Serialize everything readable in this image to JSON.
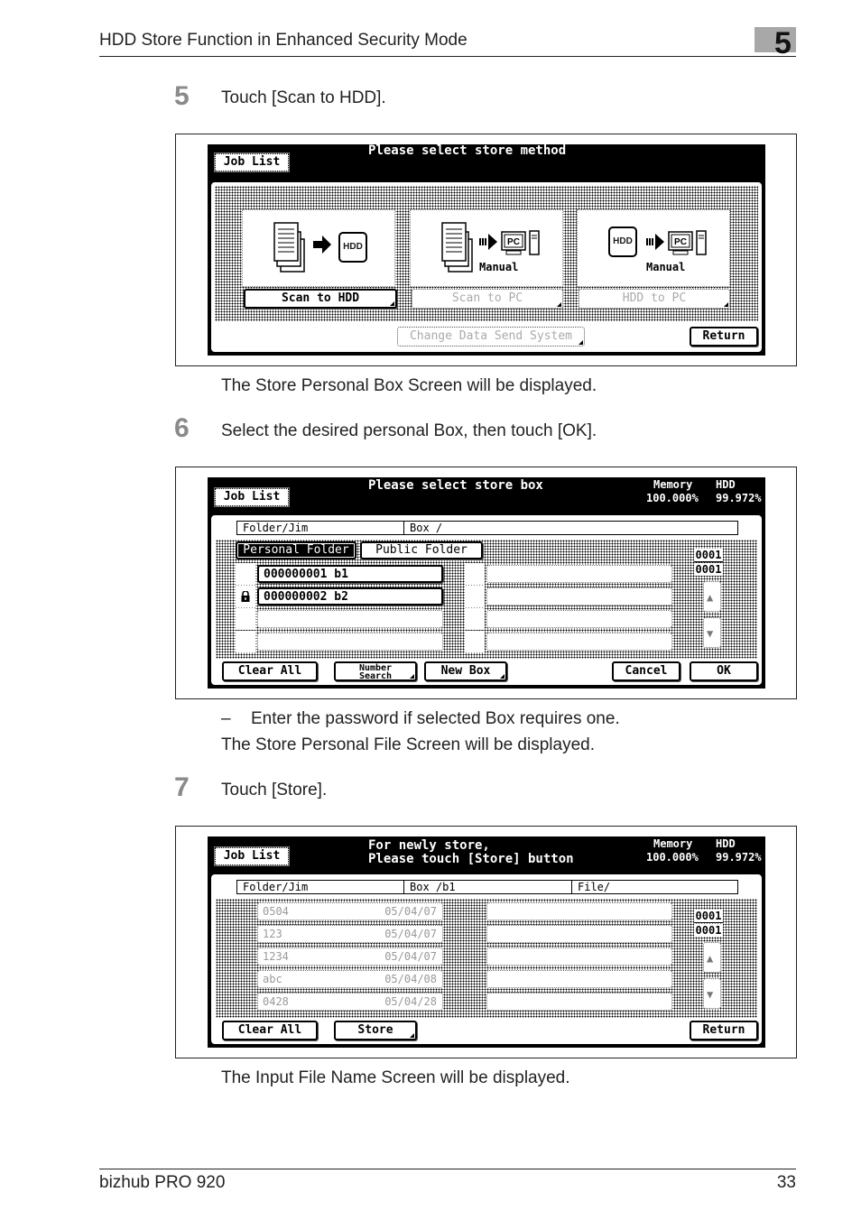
{
  "header": {
    "title": "HDD Store Function in Enhanced Security Mode",
    "chapter": "5"
  },
  "steps": [
    {
      "number": "5",
      "instruction": "Touch [Scan to HDD].",
      "result": "The Store Personal Box Screen will be displayed."
    },
    {
      "number": "6",
      "instruction": "Select the desired personal Box, then touch [OK].",
      "note": "Enter the password if selected Box requires one.",
      "result": "The Store Personal File Screen will be displayed."
    },
    {
      "number": "7",
      "instruction": "Touch [Store].",
      "result": "The Input File Name Screen will be displayed."
    }
  ],
  "screen1": {
    "job_list": "Job List",
    "title": "Please select store method",
    "methods": [
      {
        "label": "Scan to HDD",
        "caption": "",
        "enabled": true
      },
      {
        "label": "Scan to PC",
        "caption": "Manual",
        "enabled": false
      },
      {
        "label": "HDD to PC",
        "caption": "Manual",
        "enabled": false
      }
    ],
    "hdd_icon_text": "HDD",
    "pc_icon_text": "PC",
    "change_system": "Change Data Send System",
    "return": "Return"
  },
  "screen2": {
    "job_list": "Job List",
    "title": "Please select store box",
    "memory_label": "Memory",
    "memory_value": "100.000%",
    "hdd_label": "HDD",
    "hdd_value": "99.972%",
    "folder_path": "Folder/Jim",
    "box_path": "Box  /",
    "tabs": [
      {
        "label": "Personal Folder",
        "selected": true
      },
      {
        "label": "Public Folder",
        "selected": false
      }
    ],
    "boxes_left": [
      {
        "label": "000000001 b1",
        "locked": false
      },
      {
        "label": "000000002 b2",
        "locked": true
      },
      {
        "label": "",
        "locked": false
      },
      {
        "label": "",
        "locked": false
      }
    ],
    "boxes_right": [
      "",
      "",
      "",
      ""
    ],
    "page_current": "0001",
    "page_total": "0001",
    "clear_all": "Clear All",
    "number_search_1": "Number",
    "number_search_2": "Search",
    "new_box": "New Box",
    "cancel": "Cancel",
    "ok": "OK"
  },
  "screen3": {
    "job_list": "Job List",
    "title_line1": "For newly store,",
    "title_line2": "Please touch [Store] button",
    "memory_label": "Memory",
    "memory_value": "100.000%",
    "hdd_label": "HDD",
    "hdd_value": "99.972%",
    "folder_path": "Folder/Jim",
    "box_path": "Box  /b1",
    "file_path": "File/",
    "files_left": [
      {
        "name": "0504",
        "date": "05/04/07"
      },
      {
        "name": "123",
        "date": "05/04/07"
      },
      {
        "name": "1234",
        "date": "05/04/07"
      },
      {
        "name": "abc",
        "date": "05/04/08"
      },
      {
        "name": "0428",
        "date": "05/04/28"
      }
    ],
    "files_right": [
      "",
      "",
      "",
      "",
      ""
    ],
    "page_current": "0001",
    "page_total": "0001",
    "clear_all": "Clear All",
    "store": "Store",
    "return": "Return"
  },
  "footer": {
    "product": "bizhub PRO 920",
    "page": "33"
  }
}
